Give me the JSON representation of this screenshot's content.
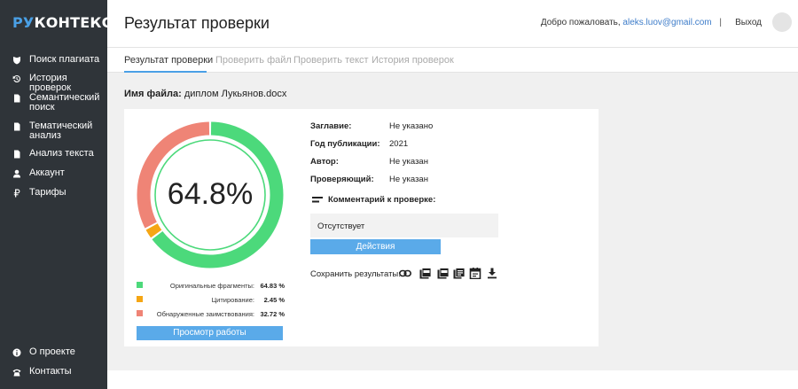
{
  "logo": {
    "part1": "РУ",
    "part2": "КОНТЕКСТ"
  },
  "sidebar": {
    "items": [
      {
        "label": "Поиск плагиата",
        "icon": "shield-icon"
      },
      {
        "label": "История проверок",
        "icon": "history-icon"
      },
      {
        "label": "Семантический поиск",
        "icon": "document-icon"
      },
      {
        "label": "Тематический анализ",
        "icon": "document-icon"
      },
      {
        "label": "Анализ текста",
        "icon": "document-icon"
      },
      {
        "label": "Аккаунт",
        "icon": "user-icon"
      },
      {
        "label": "Тарифы",
        "icon": "ruble-icon"
      }
    ],
    "bottom_items": [
      {
        "label": "О проекте",
        "icon": "info-icon"
      },
      {
        "label": "Контакты",
        "icon": "phone-icon"
      }
    ]
  },
  "header": {
    "title": "Результат проверки",
    "welcome": "Добро пожаловать,",
    "email": "aleks.luov@gmail.com",
    "separator": "|",
    "logout": "Выход"
  },
  "tabs": [
    {
      "label": "Результат проверки",
      "active": true
    },
    {
      "label": "Проверить файл",
      "active": false
    },
    {
      "label": "Проверить текст",
      "active": false
    },
    {
      "label": "История проверок",
      "active": false
    }
  ],
  "file": {
    "label": "Имя файла:",
    "name": "диплом Лукьянов.docx"
  },
  "result": {
    "percent_text": "64.8%",
    "segments": [
      {
        "label": "Оригинальные фрагменты:",
        "value_text": "64.83 %",
        "value": 64.83,
        "color": "#4cd97b"
      },
      {
        "label": "Цитирование:",
        "value_text": "2.45 %",
        "value": 2.45,
        "color": "#f5a614"
      },
      {
        "label": "Обнаруженные заимствования:",
        "value_text": "32.72 %",
        "value": 32.72,
        "color": "#ef8476"
      }
    ],
    "view_button": "Просмотр работы"
  },
  "meta": [
    {
      "label": "Заглавие:",
      "value": "Не указано"
    },
    {
      "label": "Год публикации:",
      "value": "2021"
    },
    {
      "label": "Автор:",
      "value": "Не указан"
    },
    {
      "label": "Проверяющий:",
      "value": "Не указан"
    }
  ],
  "comment": {
    "label": "Комментарий к проверке:",
    "text": "Отсутствует"
  },
  "actions_button": "Действия",
  "save": {
    "label": "Сохранить результаты:",
    "icons": [
      "link-icon",
      "pdf-icon",
      "pdf-full-icon",
      "report-icon",
      "calendar-icon",
      "download-icon"
    ]
  },
  "colors": {
    "sidebar": "#2f3439",
    "accent": "#4aa0e6",
    "button": "#5aaae9"
  }
}
